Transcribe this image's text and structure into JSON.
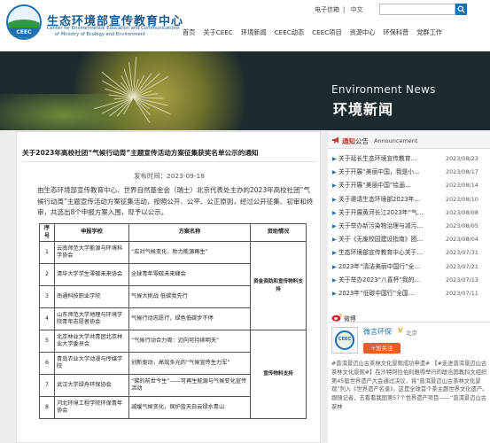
{
  "header": {
    "logo_text": "CEEC",
    "org_name": "生态环境部宣传教育中心",
    "org_name_en_line1": "Center for Environmental Education and Communications",
    "org_name_en_line2": "of Ministry of Ecology and Environment",
    "top_links": [
      "电子信箱",
      "中文"
    ],
    "search_placeholder": "",
    "nav": [
      "首页",
      "关于CEEC",
      "环境新闻",
      "CEEC动态",
      "CEEC项目",
      "资源中心",
      "环保科普",
      "党群工作"
    ]
  },
  "banner": {
    "title_en": "Environment News",
    "title_cn": "环境新闻"
  },
  "article": {
    "title": "关于2023年高校社团“气候行动周”主题宣传活动方案征集获奖名单公示的通知",
    "publish_label": "发布时间：",
    "publish_date": "2023-09-18",
    "body": "由生态环境部宣传教育中心、世界自然基金会（瑞士）北京代表处主办的2023年高校社团“气候行动周”主题宣传活动方案征集活动，按照公开、公平、公正原则，经过公开征集、初审和终审，共选出8个申报方案入围，现予以公示。",
    "table": {
      "headers": [
        "序号",
        "申报学校",
        "方案名称",
        "资助情况"
      ],
      "rows": [
        {
          "no": "1",
          "school": "云南师范大学能源与环境科学协会",
          "plan": "“应对气候变化，助力能源再生”"
        },
        {
          "no": "2",
          "school": "清华大学学生零碳未来协会",
          "plan": "全球青年零碳未来峰会"
        },
        {
          "no": "3",
          "school": "南通科技职业学院",
          "plan": "气候大挑战 低碳我先行"
        },
        {
          "no": "4",
          "school": "山东师范大学地理与环境学院青年志愿者协会",
          "plan": "气候行动志愿行，绿色低碳步不停"
        },
        {
          "no": "5",
          "school": "北京林业大学共青团北京林业大学委员会",
          "plan": "“气候行动合力周：迈向可持续明天”"
        },
        {
          "no": "6",
          "school": "青岛农业大学动漫与传媒学院",
          "plan": "创新驱动，高效多元的“气候宣传生力军”"
        },
        {
          "no": "7",
          "school": "武汉大学绿舟环保协会",
          "plan": "“碳的前世今生”——可再生能源与气候变化宣传活动"
        },
        {
          "no": "8",
          "school": "河北环境工程学院环保青年协会",
          "plan": "减缓气候变化，保护蓝天白云绿水青山"
        }
      ],
      "support_a": "资金资助和宣传物料支持",
      "support_b": "宣传物料支持"
    }
  },
  "sidebar": {
    "announcement_label": "通知",
    "announcement_label_suffix": "公告",
    "announcement_en": "Announcement",
    "items": [
      {
        "title": "关于延长生态环境宣传教育…",
        "date": "2023/08/23"
      },
      {
        "title": "关于开展“美丽中国，我是小…",
        "date": "2023/08/17"
      },
      {
        "title": "关于开展“美丽中国”绘画…",
        "date": "2023/08/14"
      },
      {
        "title": "关于邀请生态环境部2023年…",
        "date": "2023/08/10"
      },
      {
        "title": "关于开展黄河长江2023年“气…",
        "date": "2023/08/08"
      },
      {
        "title": "关于举办新污染物治理与减污…",
        "date": "2023/08/05"
      },
      {
        "title": "关于《无废校园建设指南》团…",
        "date": "2023/08/04"
      },
      {
        "title": "生态环境部宣传教育中心关于…",
        "date": "2023/07/31"
      },
      {
        "title": "2023年“清洁美丽中国行”全…",
        "date": "2023/07/21"
      },
      {
        "title": "关于举办2023“八喜杯”我的…",
        "date": "2023/07/13"
      },
      {
        "title": "2023年“低碳中国行”全国…",
        "date": "2023/07/11"
      }
    ],
    "weibo": {
      "section_label": "微博",
      "account_name": "微言环保",
      "verified": "V",
      "location": "北京",
      "follow_label": "+加关注",
      "post": "#普洱景迈山古茶林文化景观成功申遗# 【#走进普洱景迈山古茶林文化景观#】在沙特阿拉伯利雅得举行的联合国教科文组织第45届世界遗产大会通过决议，将“普洱景迈山古茶林文化景观”列入《世界遗产名录》。这是全球首个茶主题世界文化遗产。跟随记者，去看看我国第57个世界遗产项目——“普洱景迈山古茶林"
    }
  }
}
